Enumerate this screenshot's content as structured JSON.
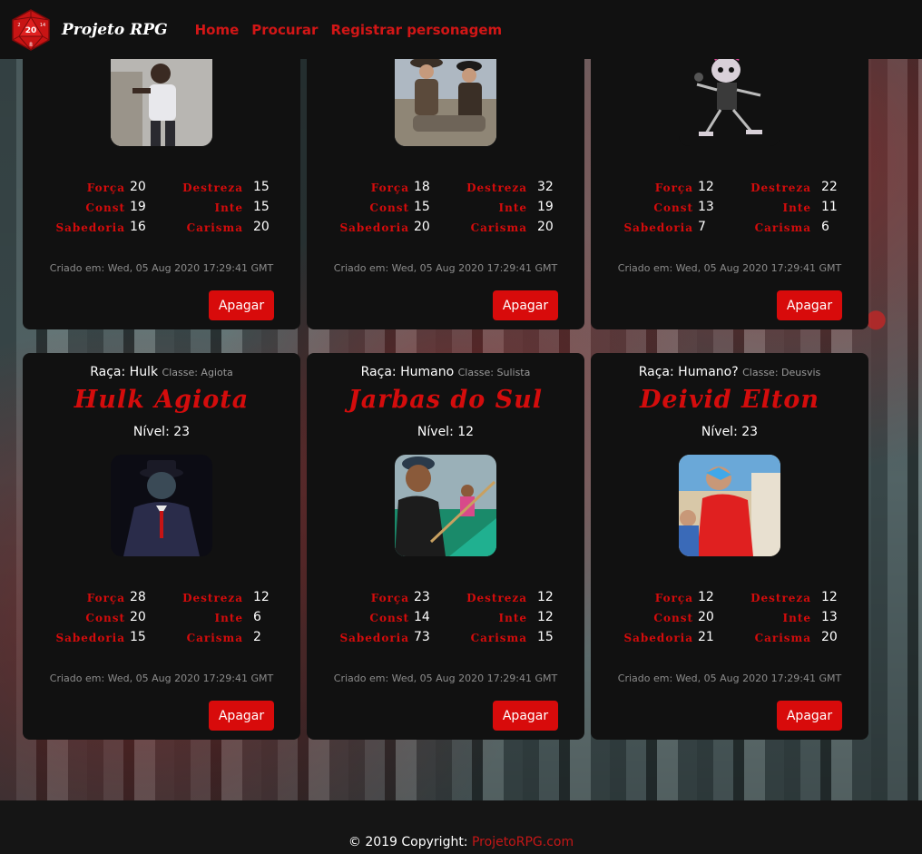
{
  "navbar": {
    "brand": "Projeto RPG",
    "logo_icon": "d20-dice-icon",
    "links": [
      "Home",
      "Procurar",
      "Registrar personagem"
    ]
  },
  "stat_labels": {
    "forca": "Força",
    "destreza": "Destreza",
    "const": "Const",
    "inte": "Inte",
    "sabedoria": "Sabedoria",
    "carisma": "Carisma"
  },
  "delete_label": "Apagar",
  "cards_top": [
    {
      "stats": {
        "forca": "20",
        "destreza": "15",
        "const": "19",
        "inte": "15",
        "sabedoria": "16",
        "carisma": "20"
      },
      "created": "Criado em: Wed, 05 Aug 2020 17:29:41 GMT"
    },
    {
      "stats": {
        "forca": "18",
        "destreza": "32",
        "const": "15",
        "inte": "19",
        "sabedoria": "20",
        "carisma": "20"
      },
      "created": "Criado em: Wed, 05 Aug 2020 17:29:41 GMT"
    },
    {
      "stats": {
        "forca": "12",
        "destreza": "22",
        "const": "13",
        "inte": "11",
        "sabedoria": "7",
        "carisma": "6"
      },
      "created": "Criado em: Wed, 05 Aug 2020 17:29:41 GMT"
    }
  ],
  "cards_bottom": [
    {
      "race_label": "Raça: Hulk",
      "class_label": "Classe: Agiota",
      "name": "Hulk Agiota",
      "level": "Nível: 23",
      "stats": {
        "forca": "28",
        "destreza": "12",
        "const": "20",
        "inte": "6",
        "sabedoria": "15",
        "carisma": "2"
      },
      "created": "Criado em: Wed, 05 Aug 2020 17:29:41 GMT"
    },
    {
      "race_label": "Raça: Humano",
      "class_label": "Classe: Sulista",
      "name": "Jarbas do Sul",
      "level": "Nível: 12",
      "stats": {
        "forca": "23",
        "destreza": "12",
        "const": "14",
        "inte": "12",
        "sabedoria": "73",
        "carisma": "15"
      },
      "created": "Criado em: Wed, 05 Aug 2020 17:29:41 GMT"
    },
    {
      "race_label": "Raça: Humano?",
      "class_label": "Classe: Deusvis",
      "name": "Deivid Elton",
      "level": "Nível: 23",
      "stats": {
        "forca": "12",
        "destreza": "12",
        "const": "20",
        "inte": "13",
        "sabedoria": "21",
        "carisma": "20"
      },
      "created": "Criado em: Wed, 05 Aug 2020 17:29:41 GMT"
    }
  ],
  "footer": {
    "text": "© 2019 Copyright: ",
    "link": "ProjetoRPG.com"
  }
}
